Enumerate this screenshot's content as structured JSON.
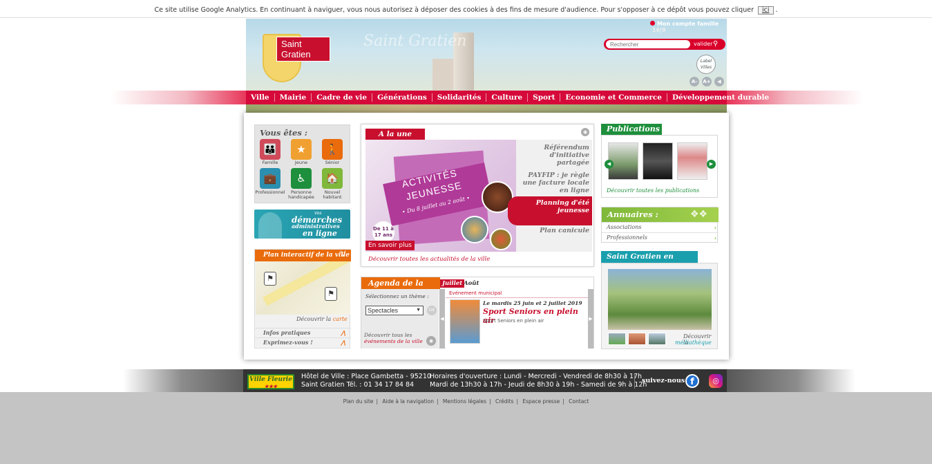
{
  "cookie": {
    "text": "Ce site utilise Google Analytics. En continuant à naviguer, vous nous autorisez à déposer des cookies à des fins de mesure d'audience. Pour s'opposer à ce dépôt vous pouvez cliquer",
    "button": "ici",
    "suffix": "."
  },
  "header": {
    "logo_text": "Saint Gratien",
    "ghost_title": "Saint Gratien",
    "account": "Mon compte famille",
    "account_badge": "16|9",
    "search_placeholder": "Rechercher",
    "search_button": "valider",
    "seal_text": "Label Villes",
    "acc_buttons": [
      "A-",
      "A+",
      "◀"
    ]
  },
  "nav": {
    "items": [
      "Ville",
      "Mairie",
      "Cadre de vie",
      "Générations",
      "Solidarités",
      "Culture",
      "Sport",
      "Economie et Commerce",
      "Développement durable"
    ]
  },
  "vous_etes": {
    "title": "Vous êtes :",
    "items": [
      {
        "label": "Famille",
        "color": "#d04a5a"
      },
      {
        "label": "Jeune",
        "color": "#f0a030"
      },
      {
        "label": "Sénior",
        "color": "#e96b0c"
      },
      {
        "label": "Professionnel",
        "color": "#2b8fb0"
      },
      {
        "label": "Personne handicapée",
        "color": "#1e8f3c"
      },
      {
        "label": "Nouvel habitant",
        "color": "#7fb83a"
      }
    ]
  },
  "demarches": {
    "line0": "Vos",
    "line1": "démarches",
    "line2": "administratives",
    "line3": "en ligne"
  },
  "plan": {
    "title": "Plan interactif de la ville",
    "link_prefix": "Découvrir la",
    "link": "carte",
    "rows": [
      "Infos pratiques",
      "Exprimez-vous !"
    ]
  },
  "une": {
    "title": "A la une",
    "image_line1": "ACTIVITÉS",
    "image_line2": "JEUNESSE",
    "image_date": "• Du 8 juillet au 2 août •",
    "image_age": "De 11 à 17 ans",
    "savoir": "En savoir plus",
    "items": [
      "Référendum d'initiative partagée",
      "PAYFIP : je règle une facture locale en ligne",
      "Planning d'été jeunesse",
      "Plan canicule"
    ],
    "more_prefix": "Découvrir toutes les",
    "more_link": "actualités de la ville"
  },
  "agenda": {
    "title": "Agenda de la ville",
    "month_active": "Juillet",
    "month_next": "Août",
    "theme_label": "Sélectionnez un thème :",
    "theme_value": "Spectacles",
    "ok": "OK",
    "decouv1": "Découvrir tous les",
    "decouv2": "événements de la ville",
    "event_category": "Evénement municipal",
    "event_date": "Le mardis 25 juin et 2 juillet 2019",
    "event_title": "Sport Seniors en plein air",
    "event_sub": "Sport Seniors en plein air"
  },
  "publications": {
    "title": "Publications",
    "link_prefix": "Découvrir toutes les",
    "link": "publications"
  },
  "annuaires": {
    "title": "Annuaires :",
    "rows": [
      "Associations",
      "Professionnels"
    ]
  },
  "images": {
    "title": "Saint Gratien en images",
    "link1": "Découvrir la",
    "link2": "médiathèque"
  },
  "footer": {
    "ville_fleurie": "Ville Fleurie",
    "stars": "★★★",
    "addr1": "Hôtel de Ville : Place Gambetta - 95210",
    "addr2": "Saint Gratien  Tél. : 01 34 17 84 84",
    "hor1": "Horaires d'ouverture : Lundi - Mercredi - Vendredi de 8h30 à 17h",
    "hor2": "Mardi de 13h30 à 17h - Jeudi de 8h30 à 19h - Samedi de 9h à 12h",
    "suivez": "suivez-nous",
    "fb": "f",
    "ig": "◎"
  },
  "sitelinks": [
    "Plan du site",
    "Aide à la navigation",
    "Mentions légales",
    "Crédits",
    "Espace presse",
    "Contact"
  ]
}
